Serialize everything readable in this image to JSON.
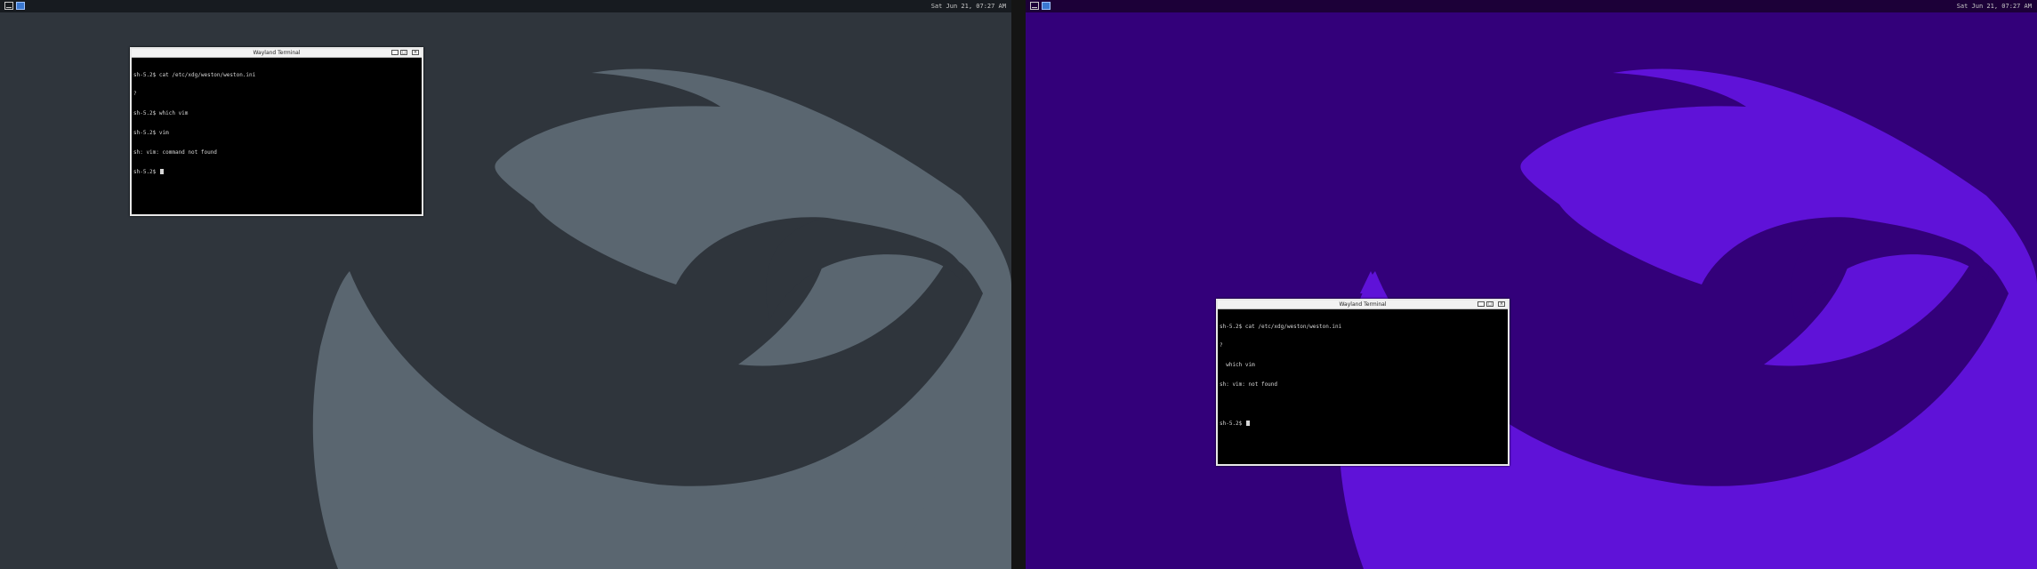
{
  "colors": {
    "left_bg": "#2f353c",
    "left_logo": "#5a6670",
    "right_bg": "#33007a",
    "right_logo": "#5f12d8",
    "terminal_bg": "#000000",
    "terminal_fg": "#d6d6d6"
  },
  "left": {
    "panel": {
      "icons": [
        "keyboard-icon",
        "app-menu-icon"
      ],
      "clock": "Sat Jun 21, 07:27 AM"
    },
    "window": {
      "title": "Wayland Terminal",
      "buttons": [
        "_",
        "□",
        "×"
      ],
      "lines": [
        "sh-5.2$ cat /etc/xdg/weston/weston.ini",
        "?",
        "sh-5.2$ which vim",
        "sh-5.2$ vim",
        "sh: vim: command not found",
        "sh-5.2$ "
      ]
    }
  },
  "right": {
    "panel": {
      "icons": [
        "keyboard-icon",
        "app-menu-icon"
      ],
      "clock": "Sat Jun 21, 07:27 AM"
    },
    "window": {
      "title": "Wayland Terminal",
      "buttons": [
        "_",
        "□",
        "×"
      ],
      "lines": [
        "sh-5.2$ cat /etc/xdg/weston/weston.ini",
        "?",
        "  which vim",
        "sh: vim: not found",
        "",
        "sh-5.2$ "
      ]
    }
  }
}
